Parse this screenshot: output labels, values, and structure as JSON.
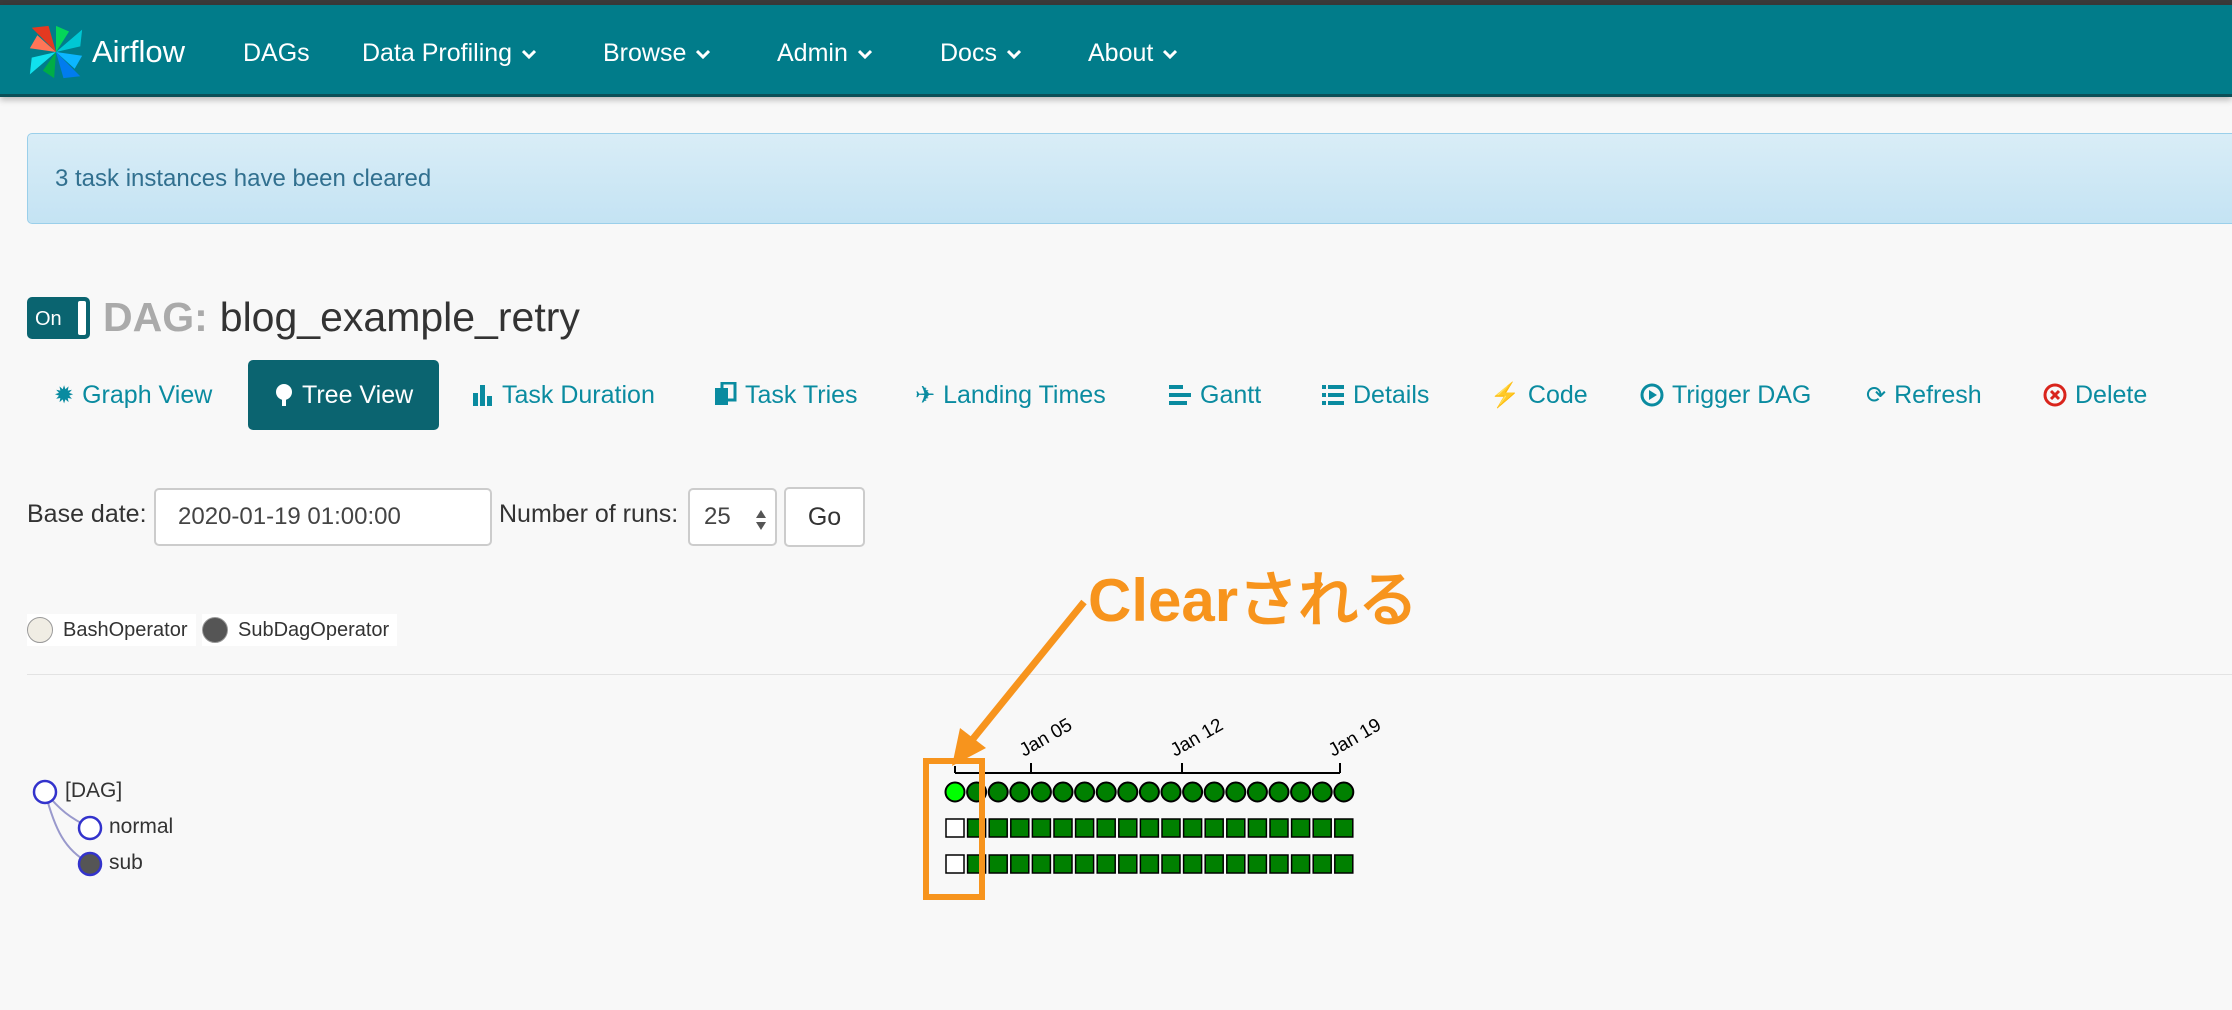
{
  "app": {
    "brand": "Airflow",
    "nav": [
      {
        "label": "DAGs"
      },
      {
        "label": "Data Profiling"
      },
      {
        "label": "Browse"
      },
      {
        "label": "Admin"
      },
      {
        "label": "Docs"
      },
      {
        "label": "About"
      }
    ]
  },
  "alert": {
    "message": "3 task instances have been cleared"
  },
  "dag": {
    "toggle_label": "On",
    "label": "DAG:",
    "name": "blog_example_retry"
  },
  "tabs": [
    {
      "label": "Graph View",
      "icon": "cog-icon"
    },
    {
      "label": "Tree View",
      "icon": "tree-icon",
      "active": true
    },
    {
      "label": "Task Duration",
      "icon": "bar-chart-icon"
    },
    {
      "label": "Task Tries",
      "icon": "duplicate-icon"
    },
    {
      "label": "Landing Times",
      "icon": "plane-icon"
    },
    {
      "label": "Gantt",
      "icon": "align-left-icon"
    },
    {
      "label": "Details",
      "icon": "list-icon"
    },
    {
      "label": "Code",
      "icon": "flash-icon"
    },
    {
      "label": "Trigger DAG",
      "icon": "play-circle-icon"
    },
    {
      "label": "Refresh",
      "icon": "refresh-icon"
    },
    {
      "label": "Delete",
      "icon": "remove-circle-icon"
    }
  ],
  "form": {
    "base_date_label": "Base date:",
    "base_date_value": "2020-01-19 01:00:00",
    "runs_label": "Number of runs:",
    "runs_value": "25",
    "go_label": "Go"
  },
  "legend": [
    {
      "label": "BashOperator",
      "color": "#f0ede4"
    },
    {
      "label": "SubDagOperator",
      "color": "#555555"
    }
  ],
  "tree": {
    "nodes": [
      {
        "label": "[DAG]"
      },
      {
        "label": "normal"
      },
      {
        "label": "sub"
      }
    ],
    "axis_ticks": [
      "Jan 05",
      "Jan 12",
      "Jan 19"
    ],
    "runs_count": 19,
    "first_run_state": "cleared",
    "success_color": "#008000",
    "running_color": "#00ff00"
  },
  "annotation": {
    "text": "Clearされる",
    "color": "#f7941d"
  }
}
